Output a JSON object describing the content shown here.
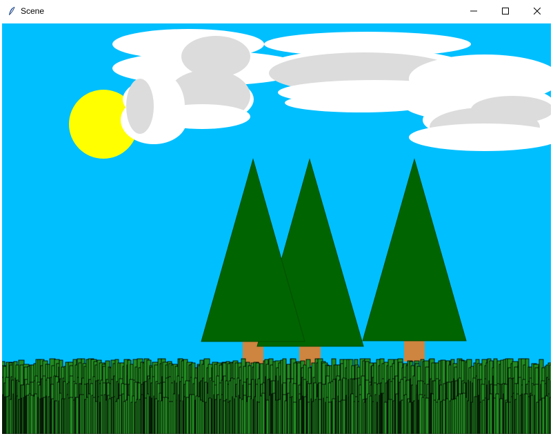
{
  "window": {
    "title": "Scene",
    "icons": {
      "app": "feather-icon",
      "minimize": "minimize-icon",
      "maximize": "maximize-icon",
      "close": "close-icon"
    }
  },
  "scene": {
    "colors": {
      "sky": "#00bfff",
      "sun": "#ffff00",
      "cloud_white": "#ffffff",
      "cloud_gray": "#dcdcdc",
      "tree": "#006400",
      "trunk": "#cd853f",
      "grass": "#228b22",
      "grass_outline": "#000000"
    },
    "trees_count": 3
  }
}
